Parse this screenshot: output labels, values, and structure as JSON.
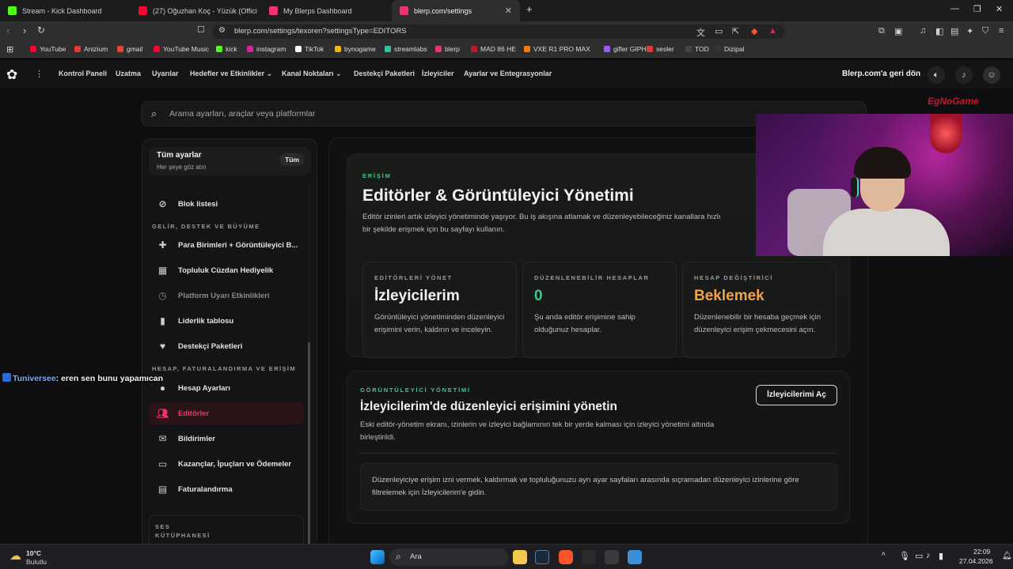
{
  "browser": {
    "tabs": [
      {
        "title": "Stream - Kick Dashboard",
        "color": "#53fc18",
        "active": false
      },
      {
        "title": "(27) Oğuzhan Koç - Yüzük (Offici",
        "color": "#ff0033",
        "active": false
      },
      {
        "title": "My Blerps Dashboard",
        "color": "#f0326e",
        "active": false
      },
      {
        "title": "blerp.com/settings",
        "color": "#f0326e",
        "active": true
      }
    ],
    "new_tab": "+",
    "url": "blerp.com/settings/texoren?settingsType=EDITORS",
    "bookmarks": [
      {
        "label": "YouTube",
        "color": "#ff0033"
      },
      {
        "label": "Anizium",
        "color": "#e53935"
      },
      {
        "label": "gmail",
        "color": "#ea4335"
      },
      {
        "label": "YouTube Music",
        "color": "#ff0033"
      },
      {
        "label": "kick",
        "color": "#53fc18"
      },
      {
        "label": "instagram",
        "color": "#d6249f"
      },
      {
        "label": "TikTok",
        "color": "#ffffff"
      },
      {
        "label": "bynogame",
        "color": "#f5b400"
      },
      {
        "label": "streamlabs",
        "color": "#31c3a2"
      },
      {
        "label": "blerp",
        "color": "#f0326e"
      },
      {
        "label": "MAD 86 HE",
        "color": "#c0192b"
      },
      {
        "label": "VXE R1 PRO MAX",
        "color": "#ff7a00"
      },
      {
        "label": "gifler GIPHY",
        "color": "#9b59ff"
      },
      {
        "label": "sesler",
        "color": "#e53935"
      },
      {
        "label": "TOD",
        "color": "#444444"
      },
      {
        "label": "Dizipal",
        "color": "#333333"
      }
    ]
  },
  "site": {
    "nav": [
      "Kontrol Paneli",
      "Uzatma",
      "Uyarılar",
      "Hedefler ve Etkinlikler",
      "Kanal Noktaları",
      "Destekçi Paketleri",
      "İzleyiciler",
      "Ayarlar ve Entegrasyonlar"
    ],
    "nav_dropdown_caret": "⌄",
    "back_link": "Blerp.com'a geri dön",
    "search_placeholder": "Arama ayarları, araçlar veya platformlar"
  },
  "sidebar": {
    "all_settings_title": "Tüm ayarlar",
    "all_settings_sub": "Her şeye göz atın",
    "all_button": "Tüm",
    "items": [
      {
        "label": "Blok listesi",
        "icon": "block-icon"
      },
      {
        "label": "Para Birimleri + Görüntüleyici B...",
        "icon": "puzzle-icon"
      },
      {
        "label": "Topluluk Cüzdan Hediyelik",
        "icon": "gift-icon"
      },
      {
        "label": "Platform Uyarı Etkinlikleri",
        "icon": "alarm-icon"
      },
      {
        "label": "Liderlik tablosu",
        "icon": "leaderboard-icon"
      },
      {
        "label": "Destekçi Paketleri",
        "icon": "supporter-icon"
      },
      {
        "label": "Hesap Ayarları",
        "icon": "person-icon"
      },
      {
        "label": "Editörler",
        "icon": "group-icon"
      },
      {
        "label": "Bildirimler",
        "icon": "mail-icon"
      },
      {
        "label": "Kazançlar, İpuçları ve Ödemeler",
        "icon": "card-icon"
      },
      {
        "label": "Faturalandırma",
        "icon": "billing-icon"
      }
    ],
    "section_growth": "GELİR, DESTEK VE BÜYÜME",
    "section_account": "HESAP, FATURALANDIRMA VE ERİŞİM",
    "section_sound_1": "SES",
    "section_sound_2": "KÜTÜPHANESİ"
  },
  "hero": {
    "eyebrow": "ERİŞİM",
    "title": "Editörler & Görüntüleyici Yönetimi",
    "description": "Editör izinleri artık izleyici yönetiminde yaşıyor. Bu iş akışına atlamak ve düzenleyebileceğiniz kanallara hızlı bir şekilde erişmek için bu sayfayı kullanın.",
    "cards": [
      {
        "label": "EDİTÖRLERİ YÖNET",
        "value": "İzleyicilerim",
        "description": "Görüntüleyici yönetiminden düzenleyici erişimini verin, kaldırın ve inceleyin.",
        "value_color": "#f2f2f2"
      },
      {
        "label": "DÜZENLENEBİLİR HESAPLAR",
        "value": "0",
        "description": "Şu anda editör erişimine sahip olduğunuz hesaplar.",
        "value_color": "#3ec98a"
      },
      {
        "label": "HESAP DEĞİŞTİRİCİ",
        "value": "Beklemek",
        "description": "Düzenlenebilir bir hesaba geçmek için düzenleyici erişim çekmecesini açın.",
        "value_color": "#f0a24a"
      }
    ]
  },
  "viewer_panel": {
    "eyebrow": "GÖRÜNTÜLEYİCİ YÖNETİMİ",
    "title": "İzleyicilerim'de düzenleyici erişimini yönetin",
    "description": "Eski editör-yönetim ekranı, izinlerin ve izleyici bağlamının tek bir yerde kalması için izleyici yönetimi altında birleştirildi.",
    "button": "İzleyicilerimi Aç",
    "info": "Düzenleyiciye erişim izni vermek, kaldırmak ve topluluğunuzu ayrı ayar sayfaları arasında sıçramadan düzenleyici izinlerine göre filtrelemek için İzleyicilerim'e gidin."
  },
  "overlay": {
    "chat_user": "Tuniversee",
    "chat_message": ": eren sen bunu yapamıcan",
    "sponsor_logo": "EgNoGame"
  },
  "taskbar": {
    "weather_temp": "10°C",
    "weather_desc": "Bulutlu",
    "search": "Ara",
    "time": "22:09",
    "date": "27.04.2026"
  }
}
